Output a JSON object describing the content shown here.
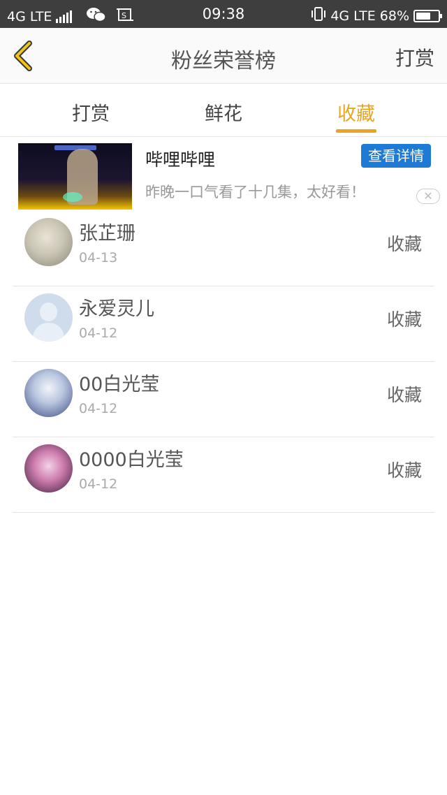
{
  "status_bar": {
    "network_left": "4G LTE",
    "time": "09:38",
    "network_right": "4G LTE",
    "battery": "68%",
    "battery_level": 0.68
  },
  "header": {
    "title": "粉丝荣誉榜",
    "action": "打赏"
  },
  "tabs": [
    {
      "label": "打赏",
      "active": false
    },
    {
      "label": "鲜花",
      "active": false
    },
    {
      "label": "收藏",
      "active": true
    }
  ],
  "ad": {
    "name": "哔哩哔哩",
    "description": "昨晚一口气看了十几集，太好看！",
    "button": "查看详情"
  },
  "list": [
    {
      "name": "张芷珊",
      "date": "04-13",
      "action": "收藏"
    },
    {
      "name": "永爱灵儿",
      "date": "04-12",
      "action": "收藏"
    },
    {
      "name": "00白光莹",
      "date": "04-12",
      "action": "收藏"
    },
    {
      "name": "0000白光莹",
      "date": "04-12",
      "action": "收藏"
    }
  ],
  "colors": {
    "accent": "#e9a51e",
    "status_bar": "#3e3e3e",
    "ad_button": "#1f7ad6"
  }
}
